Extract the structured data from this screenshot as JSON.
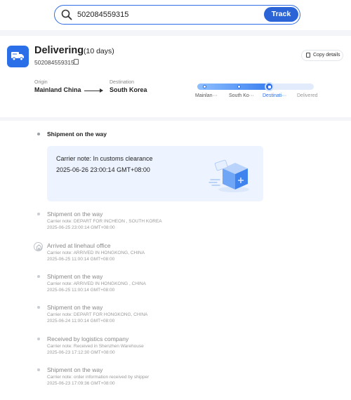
{
  "search": {
    "value": "502084559315",
    "track_label": "Track"
  },
  "header": {
    "status": "Delivering",
    "days": "(10 days)",
    "tracking_number": "502084559315",
    "copy_details_label": "Copy details",
    "origin_label": "Origin",
    "origin": "Mainland China",
    "destination_label": "Destination",
    "destination": "South Korea"
  },
  "progress": {
    "fraction": 0.62,
    "stages": [
      "Mainlan···",
      "South Ko···",
      "Destinati···",
      "Delivered"
    ],
    "current_stage": 2
  },
  "colors": {
    "accent": "#2a6fe8",
    "card_bg": "#eef4ff"
  },
  "current_event": {
    "title": "Shipment on the way",
    "note": "Carrier note: In customs clearance",
    "time": "2025-06-26 23:00:14 GMT+08:00"
  },
  "events": [
    {
      "title": "Shipment on the way",
      "note": "Carrier note: DEPART FOR INCHEON , SOUTH KOREA",
      "time": "2025-06-25 23:00:14 GMT+08:00"
    },
    {
      "title": "Arrived at linehaul office",
      "note": "Carrier note: ARRIVED IN HONGKONG, CHINA",
      "time": "2025-06-25 11:00:14 GMT+08:00"
    },
    {
      "title": "Shipment on the way",
      "note": "Carrier note: ARRIVED IN HONGKONG , CHINA",
      "time": "2025-06-25 11:00:14 GMT+08:00"
    },
    {
      "title": "Shipment on the way",
      "note": "Carrier note: DEPART FOR HONGKONG, CHINA",
      "time": "2025-06-24 11:00:14 GMT+08:00"
    },
    {
      "title": "Received by logistics company",
      "note": "Carrier note: Received in Shenzhen Warehouse",
      "time": "2025-06-23 17:12:30 GMT+08:00"
    },
    {
      "title": "Shipment on the way",
      "note": "Carrier note: order information received by shipper",
      "time": "2025-06-23 17:09:36 GMT+08:00"
    }
  ]
}
